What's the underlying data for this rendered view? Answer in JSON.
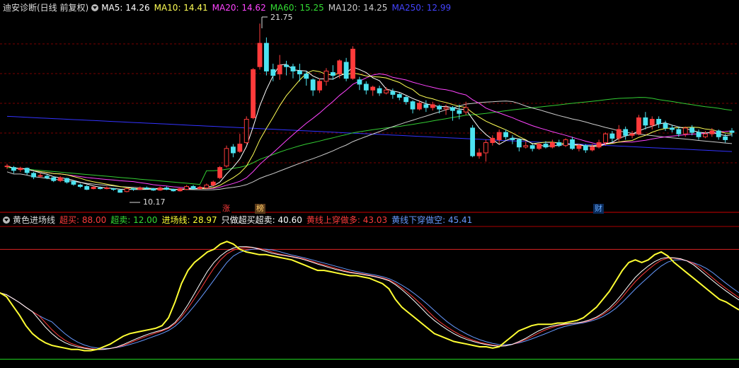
{
  "main_legend": {
    "title": "迪安诊断(日线 前复权)",
    "ma5": "MA5: 14.26",
    "ma10": "MA10: 14.41",
    "ma20": "MA20: 14.62",
    "ma60": "MA60: 15.25",
    "ma120": "MA120: 14.25",
    "ma250": "MA250: 12.99"
  },
  "annotations": {
    "high": "21.75",
    "low": "10.17",
    "tag_zhang": "涨",
    "tag_bang": "榜",
    "tag_cai": "财"
  },
  "sub_legend": {
    "title": "黄色进场线",
    "overbuy": "超买: 88.00",
    "oversell": "超卖: 12.00",
    "entry": "进场线: 28.97",
    "only": "只做超买超卖: 40.60",
    "cross_up": "黄线上穿做多: 43.03",
    "cross_down": "黄线下穿做空: 45.41"
  },
  "colors": {
    "up": "#ff3b3b",
    "down": "#4de3f0",
    "ma5": "#ffffff",
    "ma10": "#ffff55",
    "ma20": "#ff44ff",
    "ma60": "#33cc33",
    "ma120": "#cccccc",
    "ma250": "#3333ff",
    "yellow_line": "#ffff33",
    "grid": "#7a0000"
  },
  "chart_data": [
    {
      "type": "candlestick",
      "price_high": 21.75,
      "price_low": 10.17,
      "candles": [
        [
          11.95,
          12.0,
          12.15,
          11.8
        ],
        [
          11.9,
          11.7,
          12.0,
          11.5
        ],
        [
          11.75,
          11.85,
          11.95,
          11.6
        ],
        [
          11.85,
          11.55,
          11.9,
          11.4
        ],
        [
          11.5,
          11.25,
          11.6,
          11.1
        ],
        [
          11.3,
          11.35,
          11.5,
          11.2
        ],
        [
          11.3,
          11.2,
          11.4,
          11.1
        ],
        [
          11.2,
          11.0,
          11.3,
          10.9
        ],
        [
          11.0,
          11.2,
          11.3,
          10.9
        ],
        [
          11.15,
          10.9,
          11.2,
          10.8
        ],
        [
          10.95,
          10.75,
          11.0,
          10.65
        ],
        [
          10.7,
          10.6,
          10.8,
          10.5
        ],
        [
          10.6,
          10.4,
          10.7,
          10.35
        ],
        [
          10.45,
          10.55,
          10.6,
          10.4
        ],
        [
          10.5,
          10.45,
          10.6,
          10.4
        ],
        [
          10.45,
          10.5,
          10.6,
          10.4
        ],
        [
          10.45,
          10.4,
          10.5,
          10.3
        ],
        [
          10.35,
          10.2,
          10.4,
          10.17
        ],
        [
          10.25,
          10.45,
          10.5,
          10.2
        ],
        [
          10.45,
          10.4,
          10.5,
          10.3
        ],
        [
          10.4,
          10.5,
          10.6,
          10.35
        ],
        [
          10.5,
          10.45,
          10.6,
          10.4
        ],
        [
          10.45,
          10.35,
          10.5,
          10.3
        ],
        [
          10.35,
          10.5,
          10.6,
          10.3
        ],
        [
          10.5,
          10.4,
          10.6,
          10.35
        ],
        [
          10.4,
          10.3,
          10.45,
          10.25
        ],
        [
          10.3,
          10.45,
          10.5,
          10.25
        ],
        [
          10.4,
          10.6,
          10.7,
          10.35
        ],
        [
          10.6,
          10.45,
          10.7,
          10.4
        ],
        [
          10.45,
          10.55,
          10.65,
          10.4
        ],
        [
          10.5,
          10.7,
          10.8,
          10.45
        ],
        [
          10.7,
          10.9,
          11.0,
          10.6
        ],
        [
          11.2,
          11.9,
          12.0,
          11.1
        ],
        [
          12.0,
          13.2,
          13.4,
          11.9
        ],
        [
          13.3,
          12.9,
          13.5,
          12.6
        ],
        [
          13.0,
          13.5,
          14.2,
          12.9
        ],
        [
          13.6,
          15.2,
          15.4,
          13.5
        ],
        [
          15.3,
          18.6,
          18.7,
          15.2
        ],
        [
          18.8,
          20.4,
          21.75,
          18.6
        ],
        [
          20.4,
          18.5,
          20.8,
          18.2
        ],
        [
          18.6,
          18.2,
          19.0,
          17.8
        ],
        [
          18.3,
          18.9,
          19.6,
          17.9
        ],
        [
          18.9,
          18.8,
          19.2,
          18.2
        ],
        [
          18.8,
          18.5,
          19.0,
          18.0
        ],
        [
          18.5,
          18.3,
          19.0,
          17.8
        ],
        [
          18.3,
          18.0,
          18.5,
          17.5
        ],
        [
          17.9,
          17.2,
          18.0,
          16.8
        ],
        [
          17.2,
          17.8,
          18.0,
          17.0
        ],
        [
          17.8,
          18.5,
          18.7,
          17.5
        ],
        [
          18.4,
          18.2,
          18.9,
          17.9
        ],
        [
          18.3,
          19.2,
          19.3,
          18.0
        ],
        [
          19.1,
          18.0,
          19.4,
          17.8
        ],
        [
          18.0,
          20.0,
          20.2,
          17.9
        ],
        [
          17.9,
          17.6,
          18.1,
          17.2
        ],
        [
          17.6,
          17.2,
          17.8,
          16.9
        ],
        [
          17.2,
          17.4,
          17.5,
          16.8
        ],
        [
          17.3,
          17.0,
          17.5,
          16.8
        ],
        [
          17.0,
          17.2,
          17.4,
          16.9
        ],
        [
          17.1,
          16.9,
          17.3,
          16.6
        ],
        [
          16.9,
          16.7,
          17.0,
          16.5
        ],
        [
          16.7,
          16.4,
          16.8,
          16.2
        ],
        [
          16.4,
          15.9,
          16.5,
          15.6
        ],
        [
          15.9,
          16.3,
          16.5,
          15.8
        ],
        [
          16.2,
          16.0,
          16.5,
          15.7
        ],
        [
          16.0,
          16.2,
          16.4,
          15.8
        ],
        [
          16.1,
          15.9,
          16.2,
          15.6
        ],
        [
          15.9,
          16.0,
          16.2,
          15.5
        ],
        [
          16.0,
          15.8,
          16.1,
          15.1
        ],
        [
          15.8,
          15.6,
          16.2,
          15.2
        ],
        [
          15.7,
          16.0,
          16.4,
          15.5
        ],
        [
          14.6,
          12.7,
          14.8,
          12.6
        ],
        [
          12.7,
          12.9,
          13.2,
          12.5
        ],
        [
          12.9,
          13.6,
          13.8,
          12.3
        ],
        [
          13.6,
          13.9,
          14.1,
          13.4
        ],
        [
          13.8,
          14.3,
          14.5,
          13.5
        ],
        [
          14.3,
          14.0,
          14.5,
          13.8
        ],
        [
          13.9,
          13.8,
          14.1,
          13.5
        ],
        [
          13.8,
          13.3,
          13.9,
          13.0
        ],
        [
          13.3,
          13.4,
          13.7,
          13.2
        ],
        [
          13.4,
          13.2,
          13.5,
          13.0
        ],
        [
          13.2,
          13.5,
          13.6,
          13.1
        ],
        [
          13.5,
          13.3,
          13.7,
          13.2
        ],
        [
          13.3,
          13.6,
          13.8,
          13.2
        ],
        [
          13.6,
          13.4,
          13.8,
          13.3
        ],
        [
          13.4,
          13.8,
          13.9,
          13.3
        ],
        [
          13.8,
          13.2,
          14.0,
          13.1
        ],
        [
          13.2,
          13.4,
          13.5,
          13.0
        ],
        [
          13.4,
          13.1,
          13.5,
          12.9
        ],
        [
          13.1,
          13.3,
          13.5,
          13.0
        ],
        [
          13.3,
          13.6,
          13.8,
          13.2
        ],
        [
          13.6,
          14.2,
          14.3,
          13.4
        ],
        [
          14.2,
          13.9,
          14.4,
          13.6
        ],
        [
          13.9,
          14.5,
          14.8,
          13.7
        ],
        [
          14.5,
          14.1,
          14.7,
          13.8
        ],
        [
          14.1,
          14.2,
          14.4,
          13.9
        ],
        [
          14.2,
          15.3,
          15.5,
          14.1
        ],
        [
          15.3,
          14.8,
          15.7,
          14.5
        ],
        [
          14.8,
          15.2,
          15.4,
          14.5
        ],
        [
          15.2,
          14.9,
          15.4,
          14.6
        ],
        [
          14.9,
          14.6,
          15.1,
          14.4
        ],
        [
          14.6,
          14.5,
          14.8,
          14.3
        ],
        [
          14.5,
          14.2,
          14.7,
          14.0
        ],
        [
          14.2,
          14.6,
          14.7,
          14.0
        ],
        [
          14.6,
          14.3,
          14.8,
          14.1
        ],
        [
          14.3,
          14.0,
          14.5,
          13.8
        ],
        [
          14.0,
          14.2,
          14.4,
          13.9
        ],
        [
          14.2,
          14.4,
          14.6,
          14.0
        ],
        [
          14.4,
          14.0,
          14.5,
          13.8
        ],
        [
          14.0,
          13.8,
          14.2,
          13.6
        ],
        [
          14.4,
          14.3,
          14.6,
          14.0
        ]
      ],
      "ma_values": {
        "ma5": 14.26,
        "ma10": 14.41,
        "ma20": 14.62,
        "ma60": 15.25,
        "ma120": 14.25,
        "ma250": 12.99
      }
    },
    {
      "type": "line",
      "ylim": [
        0,
        100
      ],
      "overbuy": 88.0,
      "oversell": 12.0,
      "yellow": [
        55,
        52,
        45,
        38,
        30,
        24,
        20,
        17,
        15,
        14,
        13,
        12,
        12,
        11,
        11,
        12,
        14,
        16,
        19,
        22,
        24,
        25,
        26,
        27,
        28,
        30,
        36,
        48,
        62,
        72,
        78,
        82,
        86,
        88,
        92,
        94,
        92,
        88,
        86,
        85,
        84,
        84,
        83,
        82,
        81,
        80,
        78,
        76,
        74,
        72,
        72,
        71,
        70,
        69,
        68,
        68,
        67,
        66,
        64,
        62,
        58,
        50,
        44,
        40,
        36,
        32,
        28,
        24,
        22,
        20,
        18,
        17,
        16,
        15,
        14,
        14,
        13,
        14,
        18,
        22,
        26,
        28,
        30,
        31,
        31,
        31,
        32,
        32,
        33,
        34,
        36,
        40,
        44,
        50,
        56,
        64,
        72,
        78,
        80,
        78,
        80,
        84,
        86,
        83,
        78,
        74,
        70,
        66,
        62,
        58,
        54,
        50,
        48,
        45,
        42
      ]
    }
  ]
}
